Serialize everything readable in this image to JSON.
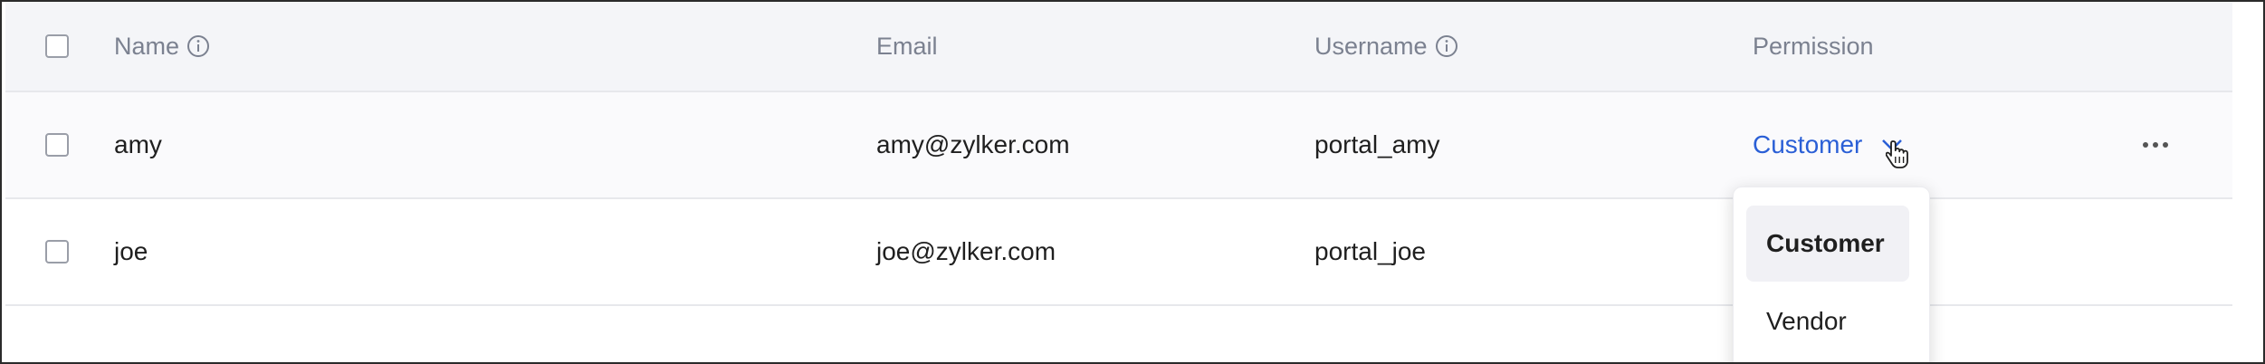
{
  "table": {
    "columns": {
      "name": "Name",
      "email": "Email",
      "username": "Username",
      "permission": "Permission"
    },
    "rows": [
      {
        "name": "amy",
        "email": "amy@zylker.com",
        "username": "portal_amy",
        "permission": "Customer"
      },
      {
        "name": "joe",
        "email": "joe@zylker.com",
        "username": "portal_joe"
      }
    ]
  },
  "permission_dropdown": {
    "options": [
      "Customer",
      "Vendor"
    ],
    "selected": "Customer"
  },
  "icons": {
    "info": "info-icon",
    "chevron": "chevron-down-icon",
    "more": "more-horizontal-icon",
    "cursor": "hand-pointer-icon"
  },
  "colors": {
    "link": "#2a5fd6",
    "header_bg": "#f4f5f8",
    "header_text": "#7b8190"
  }
}
